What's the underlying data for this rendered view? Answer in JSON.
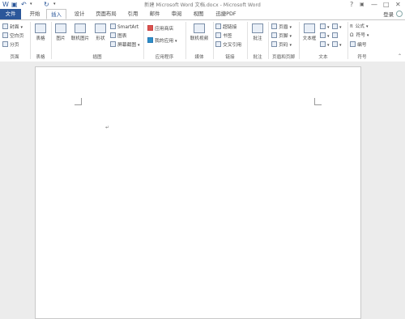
{
  "window": {
    "title": "新建 Microsoft Word 文档.docx - Microsoft Word",
    "quick_access": {
      "save_icon": "save-icon",
      "undo_icon": "undo-icon",
      "redo_icon": "redo-icon",
      "customize_icon": "customize-caret-icon"
    },
    "controls": {
      "help": "?",
      "ribbon_display": "▣",
      "minimize": "—",
      "maximize": "□",
      "close": "✕"
    }
  },
  "tabs": [
    "文件",
    "开始",
    "插入",
    "设计",
    "页面布局",
    "引用",
    "邮件",
    "审阅",
    "视图",
    "迅捷PDF"
  ],
  "active_tab": "插入",
  "account": {
    "login": "登录"
  },
  "ribbon": {
    "pages": {
      "cover": "封面",
      "blank": "空白页",
      "break": "分页",
      "label": "页面"
    },
    "tables": {
      "table": "表格",
      "label": "表格"
    },
    "illustrations": {
      "picture": "图片",
      "online_picture": "联机图片",
      "shapes": "形状",
      "smartart": "SmartArt",
      "chart": "图表",
      "screenshot": "屏幕截图",
      "label": "插图"
    },
    "apps": {
      "store": "应用商店",
      "my_apps": "我的应用",
      "label": "应用程序"
    },
    "media": {
      "online_video": "联机视频",
      "label": "媒体"
    },
    "links": {
      "hyperlink": "超链接",
      "bookmark": "书签",
      "cross_ref": "交叉引用",
      "label": "链接"
    },
    "comments": {
      "comment": "批注",
      "label": "批注"
    },
    "header_footer": {
      "header": "页眉",
      "footer": "页脚",
      "page_number": "页码",
      "label": "页眉和页脚"
    },
    "text": {
      "text_box": "文本框",
      "label": "文本"
    },
    "symbols": {
      "equation": "公式",
      "symbol": "符号",
      "numbering": "编号",
      "label": "符号"
    }
  },
  "document": {
    "paragraph_mark": "↵"
  }
}
